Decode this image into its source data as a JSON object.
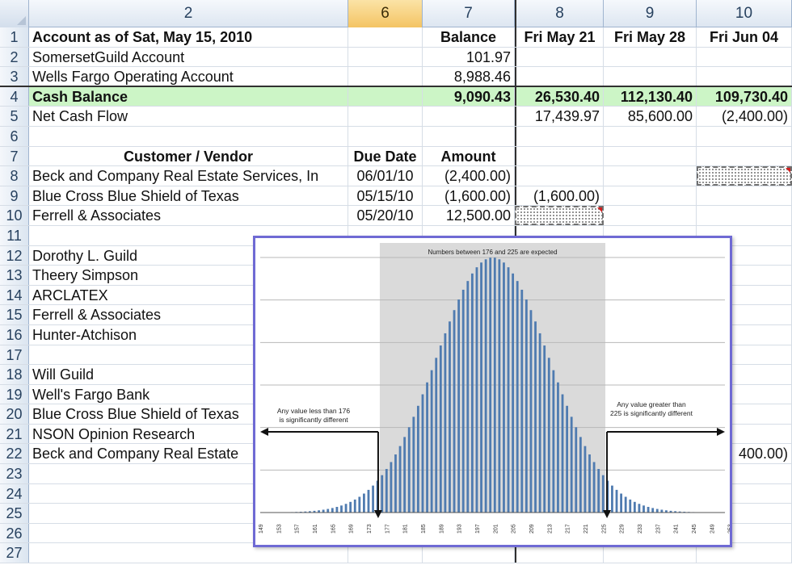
{
  "column_headers": [
    "",
    "2",
    "6",
    "7",
    "8",
    "9",
    "10"
  ],
  "selected_column": "6",
  "rows": [
    {
      "n": "1",
      "cells": [
        "Account as of Sat, May 15, 2010",
        "",
        "Balance",
        "Fri May 21",
        "Fri May 28",
        "Fri Jun 04"
      ],
      "bold": true
    },
    {
      "n": "2",
      "cells": [
        "SomersetGuild Account",
        "",
        "101.97",
        "",
        "",
        ""
      ]
    },
    {
      "n": "3",
      "cells": [
        "Wells Fargo Operating Account",
        "",
        "8,988.46",
        "",
        "",
        ""
      ]
    },
    {
      "n": "4",
      "cells": [
        "Cash Balance",
        "",
        "9,090.43",
        "26,530.40",
        "112,130.40",
        "109,730.40"
      ],
      "bold": true,
      "highlight": true
    },
    {
      "n": "5",
      "cells": [
        "Net Cash Flow",
        "",
        "",
        "17,439.97",
        "85,600.00",
        "(2,400.00)"
      ]
    },
    {
      "n": "6",
      "cells": [
        "",
        "",
        "",
        "",
        "",
        ""
      ]
    },
    {
      "n": "7",
      "cells": [
        "Customer / Vendor",
        "Due Date",
        "Amount",
        "",
        "",
        ""
      ],
      "bold": true
    },
    {
      "n": "8",
      "cells": [
        "Beck and Company Real Estate Services, In",
        "06/01/10",
        "(2,400.00)",
        "",
        "",
        ""
      ]
    },
    {
      "n": "9",
      "cells": [
        "Blue Cross Blue Shield of Texas",
        "05/15/10",
        "(1,600.00)",
        "(1,600.00)",
        "",
        ""
      ]
    },
    {
      "n": "10",
      "cells": [
        "Ferrell & Associates",
        "05/20/10",
        "12,500.00",
        "",
        "",
        ""
      ]
    },
    {
      "n": "11",
      "cells": [
        "",
        "",
        "",
        "",
        "",
        ""
      ]
    },
    {
      "n": "12",
      "cells": [
        "Dorothy L. Guild",
        "",
        "",
        "",
        "",
        ""
      ]
    },
    {
      "n": "13",
      "cells": [
        "Theery Simpson",
        "",
        "",
        "",
        "",
        ""
      ]
    },
    {
      "n": "14",
      "cells": [
        "ARCLATEX",
        "",
        "",
        "",
        "",
        ""
      ]
    },
    {
      "n": "15",
      "cells": [
        "Ferrell & Associates",
        "",
        "",
        "",
        "",
        ""
      ]
    },
    {
      "n": "16",
      "cells": [
        "Hunter-Atchison",
        "",
        "",
        "",
        "",
        ""
      ]
    },
    {
      "n": "17",
      "cells": [
        "",
        "",
        "",
        "",
        "",
        ""
      ]
    },
    {
      "n": "18",
      "cells": [
        "Will Guild",
        "",
        "",
        "",
        "",
        ""
      ]
    },
    {
      "n": "19",
      "cells": [
        "Well's Fargo Bank",
        "",
        "",
        "",
        "",
        ""
      ]
    },
    {
      "n": "20",
      "cells": [
        "Blue Cross Blue Shield of Texas",
        "",
        "",
        "",
        "",
        ""
      ]
    },
    {
      "n": "21",
      "cells": [
        "NSON Opinion Research",
        "",
        "",
        "",
        "",
        ""
      ]
    },
    {
      "n": "22",
      "cells": [
        "Beck and Company Real Estate",
        "",
        "",
        "",
        "",
        "400.00)"
      ]
    },
    {
      "n": "23",
      "cells": [
        "",
        "",
        "",
        "",
        "",
        ""
      ]
    },
    {
      "n": "24",
      "cells": [
        "",
        "",
        "",
        "",
        "",
        ""
      ]
    },
    {
      "n": "25",
      "cells": [
        "",
        "",
        "",
        "",
        "",
        ""
      ]
    },
    {
      "n": "26",
      "cells": [
        "",
        "",
        "",
        "",
        "",
        ""
      ]
    },
    {
      "n": "27",
      "cells": [
        "",
        "",
        "",
        "",
        "",
        ""
      ]
    }
  ],
  "colors": {
    "cash_highlight": "#ccf5c6",
    "selected_header": "#f4c463",
    "chart_border": "#6f6ad4",
    "bar_color": "#4f7bb0",
    "band_color": "#dadada"
  },
  "chart_data": {
    "type": "bar",
    "title": "",
    "band_annotation": "Numbers between 176 and 225 are expected",
    "left_annotation": [
      "Any value less than 176",
      "is significantly different"
    ],
    "right_annotation": [
      "Any value greater than",
      "225 is significantly different"
    ],
    "x_range": [
      149,
      252
    ],
    "expected_range": [
      176,
      225
    ],
    "distribution": {
      "mean": 200.5,
      "std_dev": 12.5,
      "peak": 1.0
    },
    "tick_labels": [
      "149",
      "153",
      "157",
      "161",
      "165",
      "169",
      "173",
      "177",
      "181",
      "185",
      "189",
      "193",
      "197",
      "201",
      "205",
      "209",
      "213",
      "217",
      "221",
      "225",
      "229",
      "233",
      "237",
      "241",
      "245",
      "249",
      "253"
    ],
    "grid": true,
    "legend": "none"
  }
}
